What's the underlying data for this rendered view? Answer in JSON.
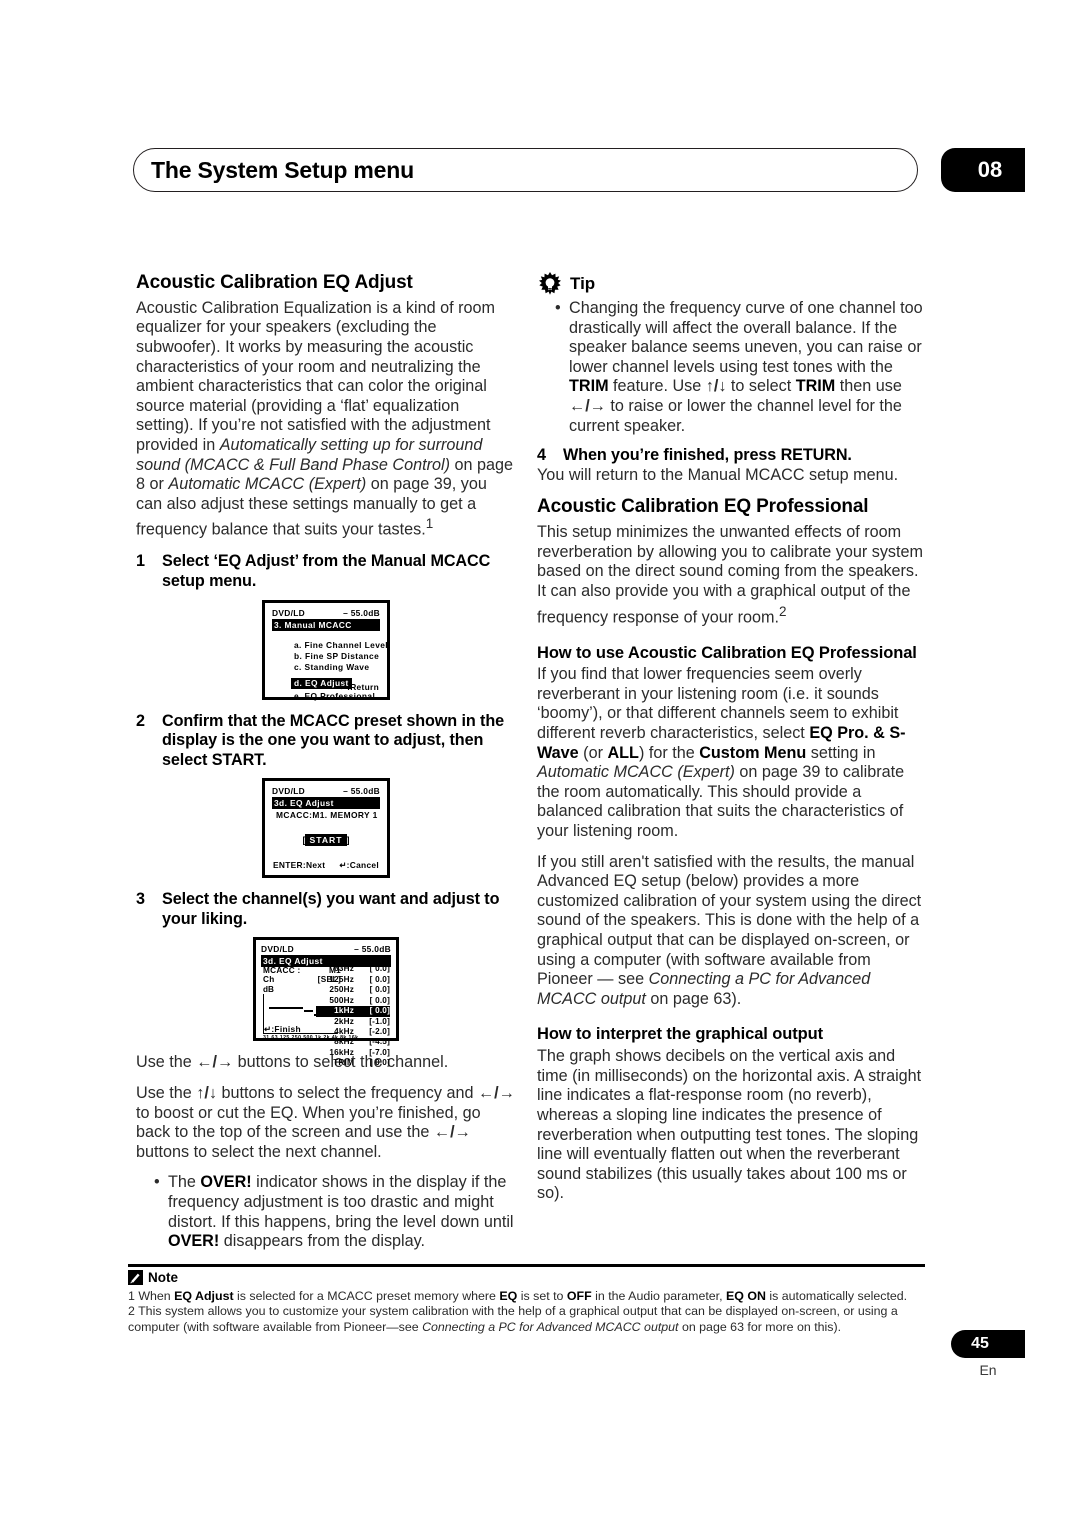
{
  "header": {
    "title": "The System Setup menu",
    "chapter": "08"
  },
  "left_column": {
    "section_title": "Acoustic Calibration EQ Adjust",
    "intro_1": "Acoustic Calibration Equalization is a kind of room equalizer for your speakers (excluding the subwoofer). It works by measuring the acoustic characteristics of your room and neutralizing the ambient characteristics that can color the original source material (providing a ‘flat’ equalization setting). If you’re not satisfied with the adjustment provided in ",
    "intro_italic_1": "Automatically setting up for surround sound (MCACC & Full Band Phase Control)",
    "intro_2": " on page 8 or ",
    "intro_italic_2": "Automatic MCACC (Expert)",
    "intro_3": " on page 39, you can also adjust these settings manually to get a frequency balance that suits your tastes.",
    "intro_footnote": "1",
    "step1_num": "1",
    "step1_text": "Select ‘EQ Adjust’ from the Manual MCACC setup menu.",
    "step2_num": "2",
    "step2_text": "Confirm that the MCACC preset shown in the display is the one you want to adjust, then select START.",
    "step3_num": "3",
    "step3_text": "Select the channel(s) you want and adjust to your liking.",
    "after3_1_a": "Use the ",
    "after3_1_arrows": "←/→",
    "after3_1_b": " buttons to select the channel.",
    "after3_2_a": "Use the ",
    "after3_2_arrows_ud": "↑/↓",
    "after3_2_b": " buttons to select the frequency and ",
    "after3_2_arrows_lr": "←/→",
    "after3_2_c": " to boost or cut the EQ. When you’re finished, go back to the top of the screen and use the ",
    "after3_2_arrows_lr2": "←/→",
    "after3_2_d": " buttons to select the next channel.",
    "bullet_a": "The ",
    "bullet_b_bold": "OVER!",
    "bullet_c": " indicator shows in the display if the frequency adjustment is too drastic and might distort. If this happens, bring the level down until ",
    "bullet_d_bold": "OVER!",
    "bullet_e": " disappears from the display."
  },
  "right_column": {
    "tip_label": "Tip",
    "tip_icon": "lightbulb-icon",
    "tip_bullet_a": "Changing the frequency curve of one channel too drastically will affect the overall balance. If the speaker balance seems uneven, you can raise or lower channel levels using test tones with the ",
    "tip_bullet_trim1": "TRIM",
    "tip_bullet_b": " feature. Use ",
    "tip_bullet_ud": "↑/↓",
    "tip_bullet_c": " to select ",
    "tip_bullet_trim2": "TRIM",
    "tip_bullet_d": " then use ",
    "tip_bullet_lr": "←/→",
    "tip_bullet_e": " to raise or lower the channel level for the current speaker.",
    "step4_num": "4",
    "step4_text": "When you’re finished, press RETURN.",
    "step4_body": "You will return to the Manual MCACC setup menu.",
    "section_title": "Acoustic Calibration EQ Professional",
    "pro_intro": "This setup minimizes the unwanted effects of room reverberation by allowing you to calibrate your system based on the direct sound coming from the speakers. It can also provide you with a graphical output of the frequency response of your room.",
    "pro_intro_footnote": "2",
    "howto_title": "How to use Acoustic Calibration EQ Professional",
    "howto_p1_a": "If you find that lower frequencies seem overly reverberant in your listening room (i.e. it sounds ‘boomy’), or that different channels seem to exhibit different reverb characteristics, select ",
    "howto_p1_b_bold": "EQ Pro. & S-Wave",
    "howto_p1_c": " (or ",
    "howto_p1_d_bold": "ALL",
    "howto_p1_e": ") for the ",
    "howto_p1_f_bold": "Custom Menu",
    "howto_p1_g": " setting in ",
    "howto_p1_h_italic": "Automatic MCACC (Expert)",
    "howto_p1_i": " on page 39 to calibrate the room automatically. This should provide a balanced calibration that suits the characteristics of your listening room.",
    "howto_p2_a": "If you still aren't satisfied with the results, the manual Advanced EQ setup (below) provides a more customized calibration of your system using the direct sound of the speakers. This is done with the help of a graphical output that can be displayed on-screen, or using a computer (with software available from Pioneer — see ",
    "howto_p2_b_italic": "Connecting a PC for Advanced MCACC output",
    "howto_p2_c": " on page 63).",
    "interpret_title": "How to interpret the graphical output",
    "interpret_body": "The graph shows decibels on the vertical axis and time (in milliseconds) on the horizontal axis. A straight line indicates a flat-response room (no reverb), whereas a sloping line indicates the presence of reverberation when outputting test tones. The sloping line will eventually flatten out when the reverberant sound stabilizes (this usually takes about 100 ms or so)."
  },
  "osd1": {
    "source": "DVD/LD",
    "volume": "– 55.0dB",
    "title_bar": "3. Manual MCACC",
    "items": [
      "a. Fine Channel Level",
      "b. Fine SP Distance",
      "c. Standing Wave",
      "d. EQ Adjust",
      "e. EQ Professional"
    ],
    "selected_index": 3,
    "footer_right": "↵:Return"
  },
  "osd2": {
    "source": "DVD/LD",
    "volume": "– 55.0dB",
    "title_bar": "3d. EQ Adjust",
    "subtitle": "MCACC:M1. MEMORY 1",
    "start_button": "START",
    "bracket_left": "[",
    "bracket_right": "]",
    "footer_left": "ENTER:Next",
    "footer_right": "↵:Cancel"
  },
  "osd3": {
    "source": "DVD/LD",
    "volume": "– 55.0dB",
    "title_bar": "3d. EQ Adjust",
    "mcacc_label": "MCACC :",
    "mcacc_value": "M1",
    "ch_label": "Ch",
    "ch_value": "[SBL]",
    "db_label": "dB",
    "footer_left": "↵:Finish",
    "graph_xlabels": "31 63 125 250 500 1k 2k 4k 8k 16k",
    "bands": [
      {
        "freq": "63Hz",
        "value": "0.0",
        "selected": false
      },
      {
        "freq": "125Hz",
        "value": "0.0",
        "selected": false
      },
      {
        "freq": "250Hz",
        "value": "0.0",
        "selected": false
      },
      {
        "freq": "500Hz",
        "value": "0.0",
        "selected": false
      },
      {
        "freq": "1kHz",
        "value": "0.0",
        "selected": true
      },
      {
        "freq": "2kHz",
        "value": "-1.0",
        "selected": false
      },
      {
        "freq": "4kHz",
        "value": "-2.0",
        "selected": false
      },
      {
        "freq": "8kHz",
        "value": "-4.5",
        "selected": false
      },
      {
        "freq": "16kHz",
        "value": "-7.0",
        "selected": false
      },
      {
        "freq": "TRIM",
        "value": "0.0",
        "selected": false
      }
    ]
  },
  "footer": {
    "note_label": "Note",
    "note_icon": "pencil-note-icon",
    "note1_a": "1 When ",
    "note1_b_bold": "EQ Adjust",
    "note1_c": " is selected for a MCACC preset memory where ",
    "note1_d_bold": "EQ",
    "note1_e": " is set to ",
    "note1_f_bold": "OFF",
    "note1_g": " in the Audio parameter, ",
    "note1_h_bold": "EQ ON",
    "note1_i": " is automatically selected.",
    "note2_a": "2 This system allows you to customize your system calibration with the help of a graphical output that can be displayed on-screen, or using a computer (with software available from Pioneer—see ",
    "note2_b_italic": "Connecting a PC for Advanced MCACC output",
    "note2_c": " on page 63 for more on this).",
    "page_number": "45",
    "language": "En"
  }
}
